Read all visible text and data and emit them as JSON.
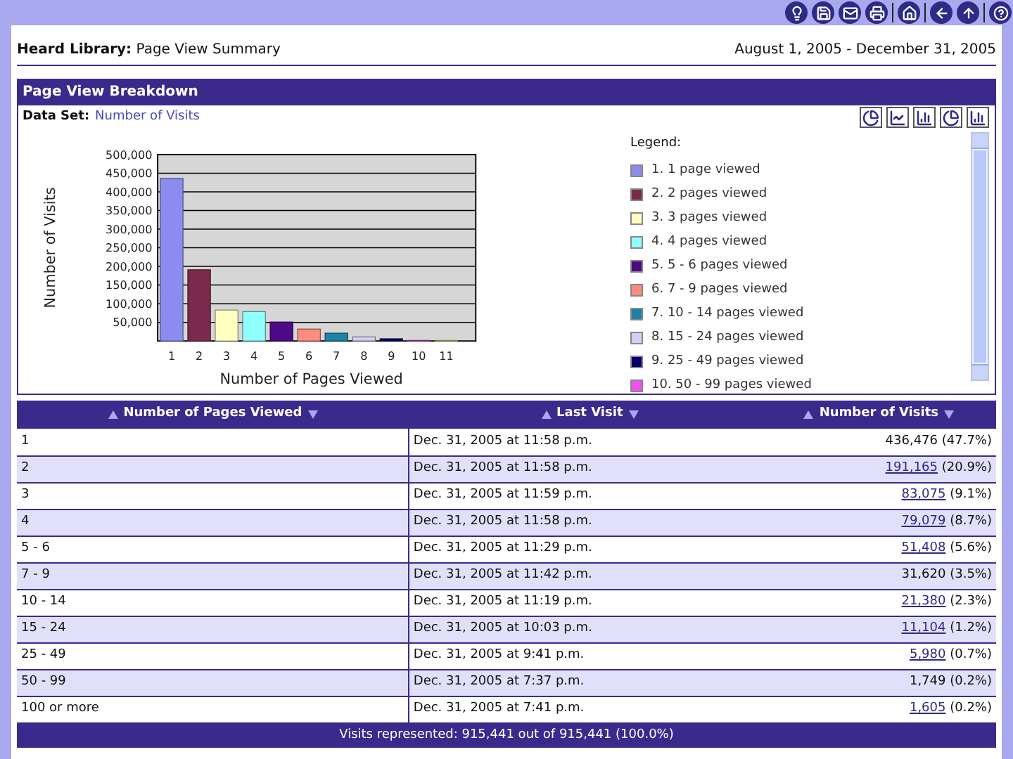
{
  "report": {
    "title": "**Heard Library:** Page View Summary",
    "date_range": "August 1, 2005 - December 31, 2005"
  },
  "panel": {
    "title": "Page View Breakdown",
    "data_set_label": "Data Set:",
    "data_set_value": "Number of Visits",
    "chart_data": {
      "type": "bar",
      "xlabel": "Number of Pages Viewed",
      "ylabel": "Number of Visits",
      "categories": [
        "1",
        "2",
        "3",
        "4",
        "5",
        "6",
        "7",
        "8",
        "9",
        "10",
        "11"
      ],
      "values": [
        436000,
        191000,
        83000,
        79000,
        51000,
        32000,
        21000,
        11000,
        6000,
        1700,
        1600
      ],
      "grid": true,
      "colors": [
        "#8c8cf0",
        "#7c2a4c",
        "#ffffc0",
        "#90ffff",
        "#4e0a86",
        "#ff8c80",
        "#1a84a8",
        "#d0d0f4",
        "#000070",
        "#f050f0",
        "#ffff90"
      ],
      "ylim": [
        0,
        500000
      ],
      "yticks": [
        {
          "value": 50000,
          "label": "50,000"
        },
        {
          "value": 100000,
          "label": "100,000"
        },
        {
          "value": 150000,
          "label": "150,000"
        },
        {
          "value": 200000,
          "label": "200,000"
        },
        {
          "value": 250000,
          "label": "250,000"
        },
        {
          "value": 300000,
          "label": "300,000"
        },
        {
          "value": 350000,
          "label": "350,000"
        },
        {
          "value": 400000,
          "label": "400,000"
        },
        {
          "value": 450000,
          "label": "450,000"
        },
        {
          "value": 500000,
          "label": "500,000"
        }
      ]
    },
    "legend": {
      "title": "Legend:",
      "items": [
        {
          "label": "1. 1 page viewed",
          "color": "#8c8cf0"
        },
        {
          "label": "2. 2 pages viewed",
          "color": "#7c2a4c"
        },
        {
          "label": "3. 3 pages viewed",
          "color": "#ffffc0"
        },
        {
          "label": "4. 4 pages viewed",
          "color": "#90ffff"
        },
        {
          "label": "5. 5 - 6 pages viewed",
          "color": "#4e0a86"
        },
        {
          "label": "6. 7 - 9 pages viewed",
          "color": "#ff8c80"
        },
        {
          "label": "7. 10 - 14 pages viewed",
          "color": "#1a84a8"
        },
        {
          "label": "8. 15 - 24 pages viewed",
          "color": "#d0d0f4"
        },
        {
          "label": "9. 25 - 49 pages viewed",
          "color": "#000070"
        },
        {
          "label": "10. 50 - 99 pages viewed",
          "color": "#f050f0"
        }
      ]
    }
  },
  "table": {
    "columns": [
      "Number of Pages Viewed",
      "Last Visit",
      "Number of Visits"
    ],
    "rows": [
      {
        "pages": "1",
        "last_visit": "Dec. 31, 2005 at 11:58 p.m.",
        "visits": "436,476",
        "share": "(47.7%)",
        "linked": false
      },
      {
        "pages": "2",
        "last_visit": "Dec. 31, 2005 at 11:58 p.m.",
        "visits": "191,165",
        "share": "(20.9%)",
        "linked": true
      },
      {
        "pages": "3",
        "last_visit": "Dec. 31, 2005 at 11:59 p.m.",
        "visits": "83,075",
        "share": "(9.1%)",
        "linked": true
      },
      {
        "pages": "4",
        "last_visit": "Dec. 31, 2005 at 11:58 p.m.",
        "visits": "79,079",
        "share": "(8.7%)",
        "linked": true
      },
      {
        "pages": "5 - 6",
        "last_visit": "Dec. 31, 2005 at 11:29 p.m.",
        "visits": "51,408",
        "share": "(5.6%)",
        "linked": true
      },
      {
        "pages": "7 - 9",
        "last_visit": "Dec. 31, 2005 at 11:42 p.m.",
        "visits": "31,620",
        "share": "(3.5%)",
        "linked": false
      },
      {
        "pages": "10 - 14",
        "last_visit": "Dec. 31, 2005 at 11:19 p.m.",
        "visits": "21,380",
        "share": "(2.3%)",
        "linked": true
      },
      {
        "pages": "15 - 24",
        "last_visit": "Dec. 31, 2005 at 10:03 p.m.",
        "visits": "11,104",
        "share": "(1.2%)",
        "linked": true
      },
      {
        "pages": "25 - 49",
        "last_visit": "Dec. 31, 2005 at 9:41 p.m.",
        "visits": "5,980",
        "share": "(0.7%)",
        "linked": true
      },
      {
        "pages": "50 - 99",
        "last_visit": "Dec. 31, 2005 at 7:37 p.m.",
        "visits": "1,749",
        "share": "(0.2%)",
        "linked": false
      },
      {
        "pages": "100 or more",
        "last_visit": "Dec. 31, 2005 at 7:41 p.m.",
        "visits": "1,605",
        "share": "(0.2%)",
        "linked": true
      }
    ],
    "footer": "Visits represented: 915,441 out of 915,441 (100.0%)"
  }
}
